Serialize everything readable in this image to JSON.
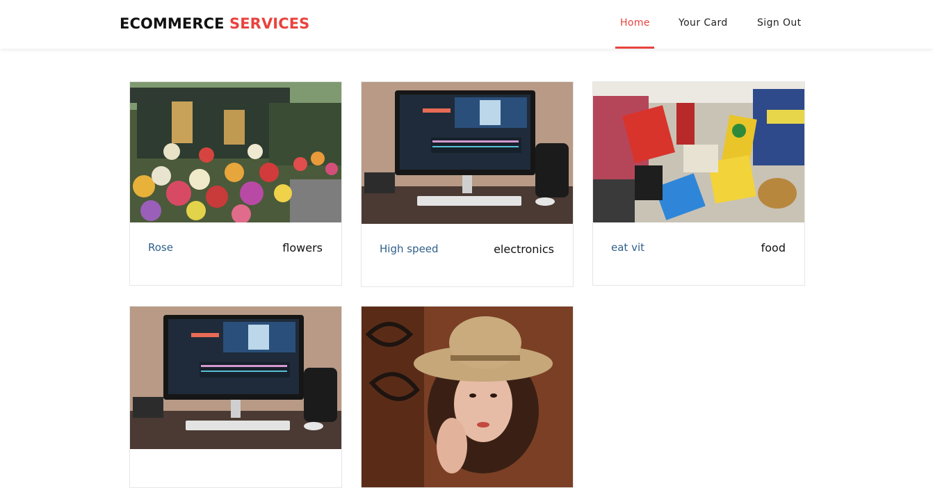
{
  "brand": {
    "part1": "ECOMMERCE",
    "part2": "SERVICES"
  },
  "nav": {
    "home": "Home",
    "card": "Your Card",
    "signout": "Sign Out"
  },
  "colors": {
    "accent": "#e8433e",
    "product_name": "#2e5f8a",
    "text": "#111111"
  },
  "products": [
    {
      "name": "Rose",
      "category": "flowers",
      "image": "flower-shop-photo"
    },
    {
      "name": "High speed",
      "category": "electronics",
      "image": "computer-monitor-photo"
    },
    {
      "name": "eat vit",
      "category": "food",
      "image": "grocery-cart-photo"
    },
    {
      "name": "",
      "category": "",
      "image": "computer-monitor-photo"
    },
    {
      "name": "",
      "category": "",
      "image": "woman-in-hat-photo"
    }
  ]
}
